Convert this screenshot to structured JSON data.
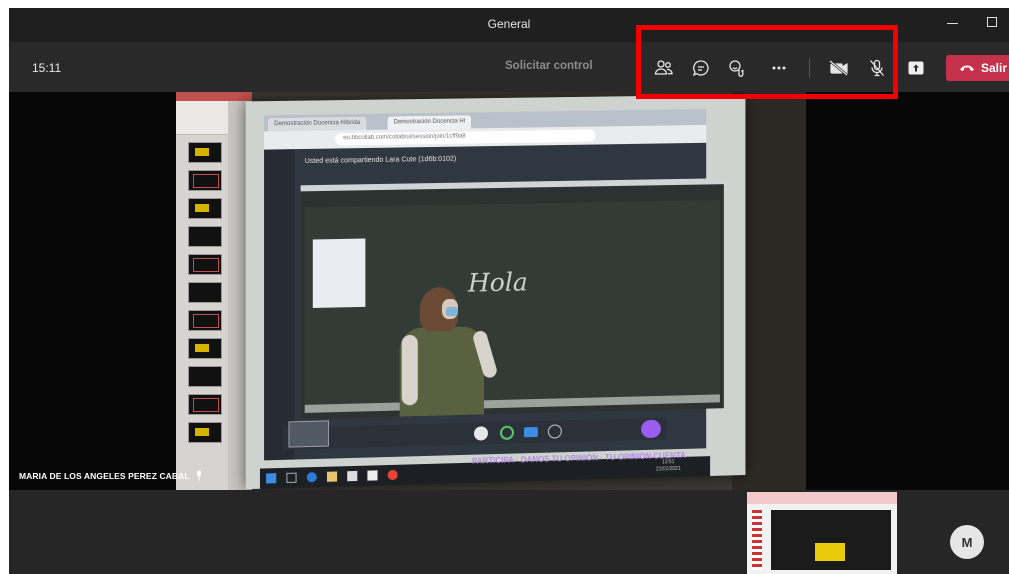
{
  "window": {
    "title": "General"
  },
  "toolbar": {
    "time": "15:11",
    "request_control": "Solicitar control",
    "leave_label": "Salir"
  },
  "shared_screen": {
    "browser_tabs": [
      "Demostración Docencia Híbrida",
      "Demostración Docencia Hí"
    ],
    "url": "eu.bbcollab.com/collab/ui/session/join/1cff9a8",
    "sharing_notice": "Usted está compartiendo Lara Cute (1d6b:0102)",
    "board_text": "Hola",
    "banner": "PARTICIPA · DANOS TU OPINIÓN · TU OPINIÓN CUENTA",
    "taskbar_time": "13:51",
    "taskbar_date": "21/01/2021"
  },
  "participant": {
    "name": "MARIA DE LOS ANGELES PEREZ CABAL",
    "avatar_initial": "M"
  },
  "colors": {
    "leave": "#c4314b",
    "highlight": "#f20000",
    "toolbar": "#292929"
  }
}
